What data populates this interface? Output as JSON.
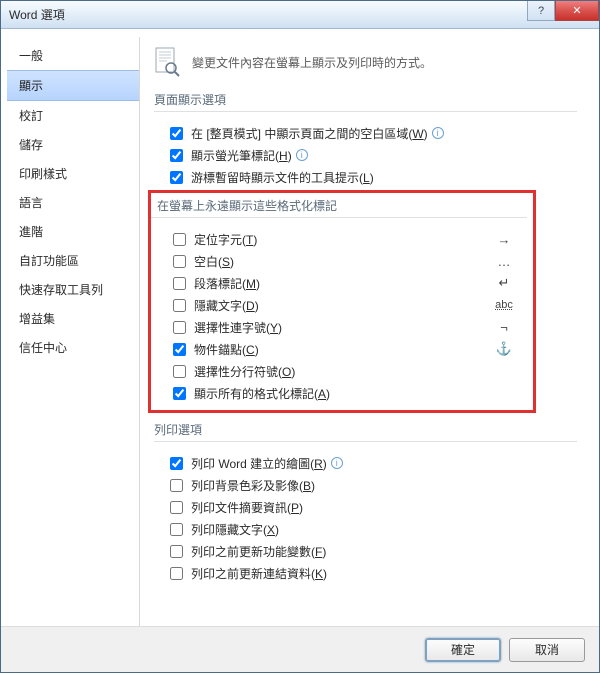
{
  "window": {
    "title": "Word 選項"
  },
  "sidebar": {
    "items": [
      {
        "label": "一般"
      },
      {
        "label": "顯示"
      },
      {
        "label": "校訂"
      },
      {
        "label": "儲存"
      },
      {
        "label": "印刷樣式"
      },
      {
        "label": "語言"
      },
      {
        "label": "進階"
      },
      {
        "label": "自訂功能區"
      },
      {
        "label": "快速存取工具列"
      },
      {
        "label": "增益集"
      },
      {
        "label": "信任中心"
      }
    ],
    "selected_index": 1
  },
  "header": {
    "description": "變更文件內容在螢幕上顯示及列印時的方式。"
  },
  "sections": {
    "page_display": {
      "title": "頁面顯示選項",
      "options": [
        {
          "label": "在 [整頁模式] 中顯示頁面之間的空白區域",
          "hotkey": "W",
          "checked": true,
          "info": true
        },
        {
          "label": "顯示螢光筆標記",
          "hotkey": "H",
          "checked": true,
          "info": true
        },
        {
          "label": "游標暫留時顯示文件的工具提示",
          "hotkey": "L",
          "checked": true
        }
      ]
    },
    "formatting_marks": {
      "title": "在螢幕上永遠顯示這些格式化標記",
      "options": [
        {
          "label": "定位字元",
          "hotkey": "T",
          "checked": false,
          "glyph": "→"
        },
        {
          "label": "空白",
          "hotkey": "S",
          "checked": false,
          "glyph": "…"
        },
        {
          "label": "段落標記",
          "hotkey": "M",
          "checked": false,
          "glyph": "↵"
        },
        {
          "label": "隱藏文字",
          "hotkey": "D",
          "checked": false,
          "glyph": "abc"
        },
        {
          "label": "選擇性連字號",
          "hotkey": "Y",
          "checked": false,
          "glyph": "¬"
        },
        {
          "label": "物件錨點",
          "hotkey": "C",
          "checked": true,
          "glyph": "⚓"
        },
        {
          "label": "選擇性分行符號",
          "hotkey": "O",
          "checked": false,
          "glyph": ""
        },
        {
          "label": "顯示所有的格式化標記",
          "hotkey": "A",
          "checked": true,
          "glyph": ""
        }
      ]
    },
    "print": {
      "title": "列印選項",
      "options": [
        {
          "label": "列印 Word 建立的繪圖",
          "hotkey": "R",
          "checked": true,
          "info": true
        },
        {
          "label": "列印背景色彩及影像",
          "hotkey": "B",
          "checked": false
        },
        {
          "label": "列印文件摘要資訊",
          "hotkey": "P",
          "checked": false
        },
        {
          "label": "列印隱藏文字",
          "hotkey": "X",
          "checked": false
        },
        {
          "label": "列印之前更新功能變數",
          "hotkey": "F",
          "checked": false
        },
        {
          "label": "列印之前更新連結資料",
          "hotkey": "K",
          "checked": false
        }
      ]
    }
  },
  "footer": {
    "ok": "確定",
    "cancel": "取消"
  }
}
